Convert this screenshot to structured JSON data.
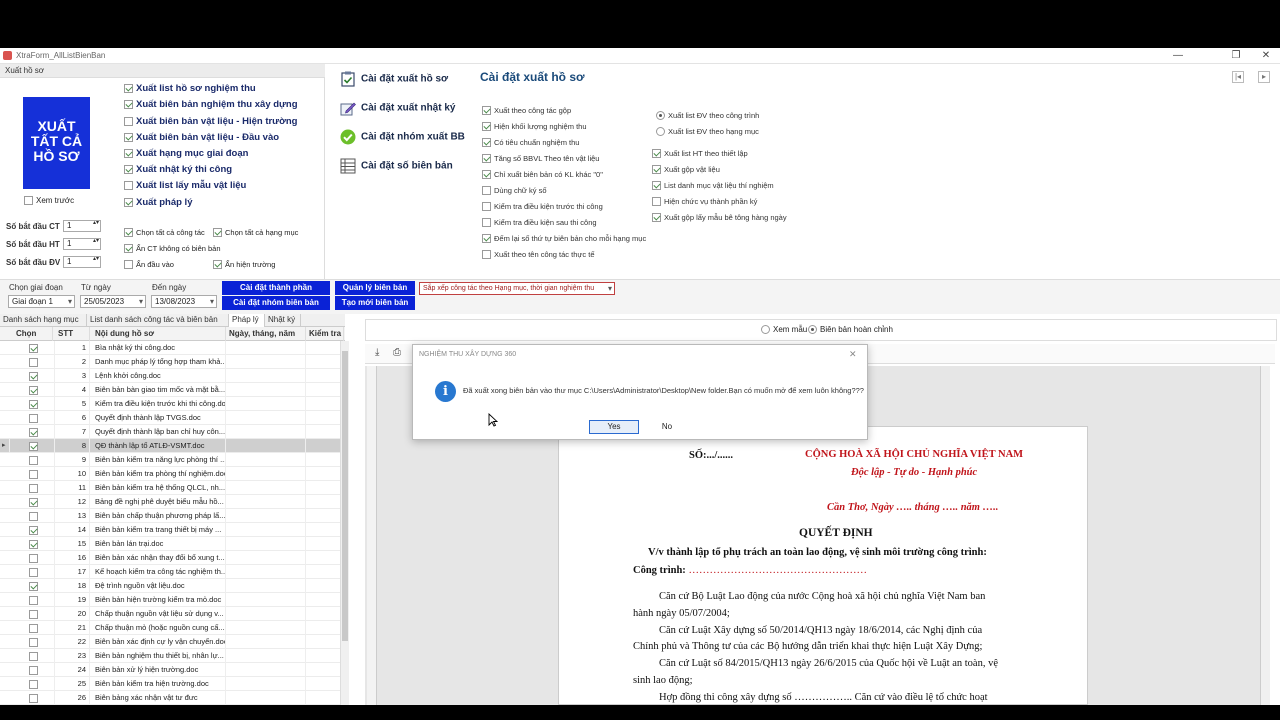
{
  "window": {
    "title": "XtraForm_AllListBienBan",
    "minimize": "—",
    "restore": "❐",
    "close": "✕"
  },
  "export_panel": {
    "header": "Xuất hồ sơ",
    "big_button": "XUẤT TẤT CẢ HỒ SƠ",
    "preview_check": "Xem trước",
    "options": [
      {
        "label": "Xuất list hồ sơ nghiệm thu",
        "checked": true
      },
      {
        "label": "Xuất biên bản nghiệm thu xây dựng",
        "checked": true
      },
      {
        "label": "Xuất biên bản vật liệu - Hiện trường",
        "checked": false
      },
      {
        "label": "Xuất biên bản vật liệu - Đầu vào",
        "checked": true
      },
      {
        "label": "Xuất hạng mục giai đoạn",
        "checked": true
      },
      {
        "label": "Xuất nhật ký thi công",
        "checked": true
      },
      {
        "label": "Xuất list lấy mẫu vật liệu",
        "checked": false
      },
      {
        "label": "Xuất pháp lý",
        "checked": true
      }
    ],
    "start_ct_label": "Số bắt đầu CT",
    "start_ht_label": "Số bắt đầu HT",
    "start_dv_label": "Số bắt đầu ĐV",
    "start_ct": "1",
    "start_ht": "1",
    "start_dv": "1",
    "small_options": [
      {
        "label": "Chọn tất cả công tác",
        "checked": true
      },
      {
        "label": "Chọn tất cả hạng mục",
        "checked": true
      },
      {
        "label": "Ẩn CT không có biên bản",
        "checked": true
      },
      {
        "label": "Ẩn đầu vào",
        "checked": false
      },
      {
        "label": "Ẩn hiện trường",
        "checked": true
      }
    ]
  },
  "menu": [
    {
      "label": "Cài đặt xuất hồ sơ",
      "icon": "clipboard-check-icon"
    },
    {
      "label": "Cài đặt xuất nhật ký",
      "icon": "edit-pencil-icon"
    },
    {
      "label": "Cài đặt nhóm xuất BB",
      "icon": "green-check-icon"
    },
    {
      "label": "Cài đặt số biên bản",
      "icon": "list-table-icon"
    }
  ],
  "settings": {
    "title": "Cài đặt xuất hồ sơ",
    "col1": [
      {
        "label": "Xuất theo công tác gộp",
        "checked": true
      },
      {
        "label": "Hiện khối lượng nghiệm thu",
        "checked": true
      },
      {
        "label": "Có tiêu chuẩn nghiệm thu",
        "checked": true
      },
      {
        "label": "Tăng số BBVL Theo tên vật liệu",
        "checked": true
      },
      {
        "label": "Chỉ xuất biên bản có KL khác \"0\"",
        "checked": true
      },
      {
        "label": "Dùng chữ ký số",
        "checked": false
      },
      {
        "label": "Kiểm tra điều kiện trước thi công",
        "checked": false
      },
      {
        "label": "Kiểm tra điều kiện sau thi công",
        "checked": false
      },
      {
        "label": "Đếm lại số thứ tự biên bản cho mỗi hạng mục",
        "checked": true
      },
      {
        "label": "Xuất theo tên công tác thực tế",
        "checked": false
      }
    ],
    "radios": [
      {
        "label": "Xuất list ĐV theo công trình",
        "checked": true
      },
      {
        "label": "Xuất list ĐV theo hạng mục",
        "checked": false
      }
    ],
    "col2": [
      {
        "label": "Xuất list HT theo thiết lập",
        "checked": true
      },
      {
        "label": "Xuất gộp vật liệu",
        "checked": true
      },
      {
        "label": "List danh mục vật liệu thí nghiệm",
        "checked": true
      },
      {
        "label": "Hiện chức vụ thành phần ký",
        "checked": false
      },
      {
        "label": "Xuất gộp lấy mẫu bê tông hàng ngày",
        "checked": true
      }
    ]
  },
  "filter": {
    "phase_label": "Chọn giai đoạn",
    "phase_value": "Giai đoạn 1",
    "from_label": "Từ ngày",
    "from_value": "25/05/2023",
    "to_label": "Đến ngày",
    "to_value": "13/08/2023",
    "btn_component": "Cài đặt thành phần",
    "btn_group": "Cài đặt nhóm biên bản",
    "btn_manage": "Quản lý biên bản",
    "btn_new": "Tạo mới biên bản",
    "sort_value": "Sắp xếp công tác theo Hạng mục, thời gian nghiệm thu"
  },
  "tabs": [
    "Danh sách hạng mục",
    "List danh sách công tác và biên bản",
    "Pháp lý",
    "Nhật ký"
  ],
  "grid": {
    "headers": [
      "Chọn",
      "STT",
      "Nội dung hồ sơ",
      "Ngày, tháng, năm",
      "Kiểm tra"
    ],
    "rows": [
      {
        "stt": "1",
        "name": "Bìa nhật ký thi công.doc",
        "checked": true
      },
      {
        "stt": "2",
        "name": "Danh mục pháp lý tổng hợp tham khả...",
        "checked": false
      },
      {
        "stt": "3",
        "name": "Lệnh khởi công.doc",
        "checked": true
      },
      {
        "stt": "4",
        "name": "Biên bản bàn giao tim mốc và mặt bằ...",
        "checked": true
      },
      {
        "stt": "5",
        "name": "Kiểm tra điều kiện trước khi thi công.doc",
        "checked": true
      },
      {
        "stt": "6",
        "name": "Quyết định thành lập TVGS.doc",
        "checked": false
      },
      {
        "stt": "7",
        "name": "Quyết định thành lập ban chỉ huy côn...",
        "checked": true
      },
      {
        "stt": "8",
        "name": "QĐ thành lập tổ ATLĐ-VSMT.doc",
        "checked": true
      },
      {
        "stt": "9",
        "name": "Biên bản kiểm tra năng lực phòng thí ...",
        "checked": false
      },
      {
        "stt": "10",
        "name": "Biên bản kiểm tra phòng thí nghiệm.doc",
        "checked": false
      },
      {
        "stt": "11",
        "name": "Biên bản kiểm tra hệ thống QLCL, nh...",
        "checked": false
      },
      {
        "stt": "12",
        "name": "Bảng đề nghị phê duyệt biểu mẫu hồ...",
        "checked": true
      },
      {
        "stt": "13",
        "name": "Biên bản chấp thuận phương pháp lấ...",
        "checked": false
      },
      {
        "stt": "14",
        "name": "Biên bản kiểm tra trang thiết bị máy ...",
        "checked": true
      },
      {
        "stt": "15",
        "name": "Biên bản lán trại.doc",
        "checked": true
      },
      {
        "stt": "16",
        "name": "Biên bản xác nhận thay đổi bổ xung t...",
        "checked": false
      },
      {
        "stt": "17",
        "name": "Kế hoạch kiểm tra công tác nghiệm th...",
        "checked": false
      },
      {
        "stt": "18",
        "name": "Đệ trình nguồn vật liệu.doc",
        "checked": true
      },
      {
        "stt": "19",
        "name": "Biên bản hiện trường kiểm tra mỏ.doc",
        "checked": false
      },
      {
        "stt": "20",
        "name": "Chấp thuận nguồn vật liệu sử dụng v...",
        "checked": false
      },
      {
        "stt": "21",
        "name": "Chấp thuận mỏ (hoặc nguồn cung cấ...",
        "checked": false
      },
      {
        "stt": "22",
        "name": "Biên bản xác định cự ly vận chuyển.doc",
        "checked": false
      },
      {
        "stt": "23",
        "name": "Biên bản nghiệm thu thiết bị, nhân lự...",
        "checked": false
      },
      {
        "stt": "24",
        "name": "Biên bản xử lý hiện trường.doc",
        "checked": false
      },
      {
        "stt": "25",
        "name": "Biên bản kiểm tra hiện trường.doc",
        "checked": false
      },
      {
        "stt": "26",
        "name": "Biên bảng xác nhận vật tư đưc",
        "checked": false
      }
    ]
  },
  "preview": {
    "mode_sample": "Xem mẫu",
    "mode_done": "Biên bản hoàn chỉnh"
  },
  "document": {
    "so": "SỐ:.../......",
    "republic": "CỘNG HOÀ XÃ HỘI CHỦ NGHĨA VIỆT NAM",
    "motto": "Độc lập - Tự do - Hạnh phúc",
    "place_date": "Cần Thơ, Ngày ….. tháng ….. năm …..",
    "decision": "QUYẾT ĐỊNH",
    "subject": "V/v thành lập tổ phụ trách an toàn lao động, vệ sinh môi trường công trình:",
    "project_label": "Công trình:",
    "project_dots": "……………………………………………",
    "lines": [
      "Căn cứ Bộ Luật Lao động của nước Cộng hoà xã hội chủ nghĩa Việt Nam ban",
      "hành ngày 05/07/2004;",
      "Căn cứ Luật Xây dựng số 50/2014/QH13 ngày 18/6/2014, các Nghị định của",
      "Chính phủ và  Thông tư của các Bộ hướng dẫn triển khai thực hiện Luật Xây Dựng;",
      "Căn cứ Luật số 84/2015/QH13 ngày 26/6/2015 của Quốc hội về Luật an toàn, vệ",
      "sinh lao động;",
      "Hợp đồng thi công xây dựng số …………….. Căn cứ vào điều lệ tổ chức hoạt"
    ]
  },
  "dialog": {
    "title": "NGHIỆM THU XÂY DỰNG 360",
    "message": "Đã xuất xong biên bản vào thư mục C:\\Users\\Administrator\\Desktop\\New folder.Bạn có muốn mở để xem luôn không???",
    "yes": "Yes",
    "no": "No",
    "close": "✕",
    "info_glyph": "i"
  }
}
